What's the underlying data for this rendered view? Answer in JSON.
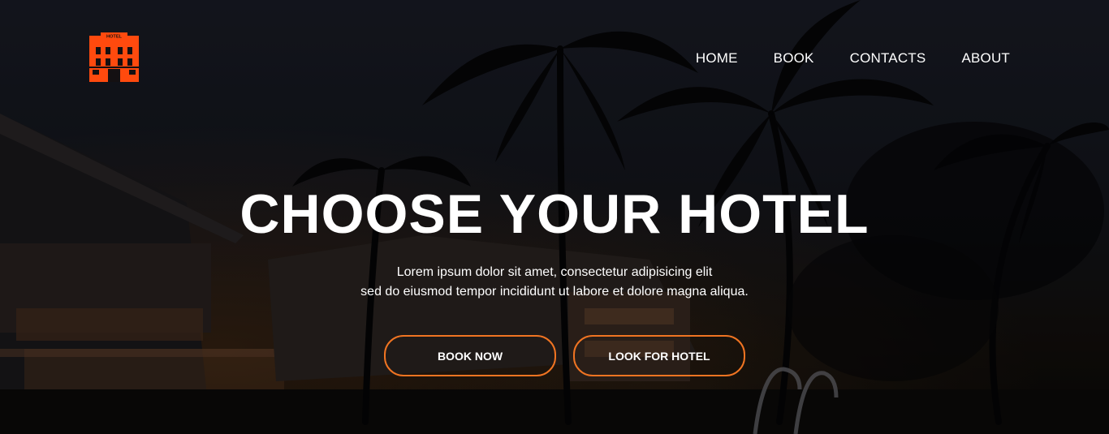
{
  "header": {
    "logo_text": "HOTEL",
    "logo_color": "#ff4a0e",
    "nav": [
      {
        "label": "HOME"
      },
      {
        "label": "BOOK"
      },
      {
        "label": "CONTACTS"
      },
      {
        "label": "ABOUT"
      }
    ]
  },
  "hero": {
    "title": "CHOOSE YOUR HOTEL",
    "subtitle_line1": "Lorem ipsum dolor sit amet, consectetur adipisicing elit",
    "subtitle_line2": "sed do eiusmod tempor incididunt ut labore et dolore magna aliqua.",
    "buttons": [
      {
        "label": "BOOK NOW"
      },
      {
        "label": "LOOK FOR HOTEL"
      }
    ],
    "accent_color": "#f07422"
  }
}
